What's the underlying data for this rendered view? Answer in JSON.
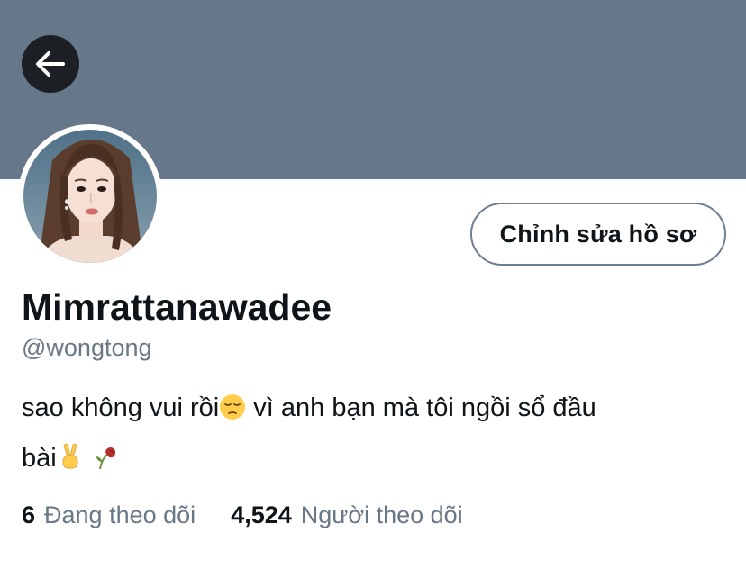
{
  "header": {
    "back_icon": "arrow-left-icon",
    "banner_color": "#66778a"
  },
  "profile": {
    "avatar_icon": "profile-photo",
    "edit_button_label": "Chỉnh sửa hồ sơ",
    "display_name": "Mimrattanawadee",
    "handle": "@wongtong",
    "bio": {
      "line1_text_a": "sao không vui rồi",
      "emoji_pensive": "pensive-face-emoji",
      "line1_text_b": " vì anh bạn mà tôi ngồi sổ đầu",
      "line2_text": "bài",
      "emoji_victory": "victory-hand-emoji",
      "emoji_wilted": "wilted-flower-emoji"
    },
    "stats": {
      "following_count": "6",
      "following_label": "Đang theo dõi",
      "followers_count": "4,524",
      "followers_label": "Người theo dõi"
    }
  },
  "colors": {
    "text_primary": "#0f1419",
    "text_secondary": "#697886",
    "button_border": "#6e7f8f"
  }
}
